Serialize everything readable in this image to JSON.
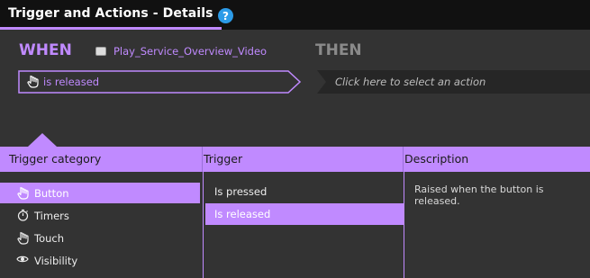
{
  "window": {
    "title": "Trigger and Actions - Details",
    "help_glyph": "?"
  },
  "when": {
    "label": "WHEN",
    "element_name": "Play_Service_Overview_Video",
    "trigger_value": "is released"
  },
  "then": {
    "label": "THEN",
    "action_placeholder": "Click here to select an action"
  },
  "panel": {
    "headers": {
      "category": "Trigger category",
      "trigger": "Trigger",
      "description": "Description"
    },
    "categories": [
      {
        "label": "Button",
        "icon": "hand-pointer-icon",
        "selected": true
      },
      {
        "label": "Timers",
        "icon": "stopwatch-icon",
        "selected": false
      },
      {
        "label": "Touch",
        "icon": "hand-pointer-icon",
        "selected": false
      },
      {
        "label": "Visibility",
        "icon": "eye-icon",
        "selected": false
      }
    ],
    "triggers": [
      {
        "label": "Is pressed",
        "selected": false
      },
      {
        "label": "Is released",
        "selected": true
      }
    ],
    "description": "Raised when the button is released."
  },
  "colors": {
    "accent": "#c08aff",
    "background": "#333333",
    "titlebar": "#111111",
    "help": "#2c9be8"
  }
}
